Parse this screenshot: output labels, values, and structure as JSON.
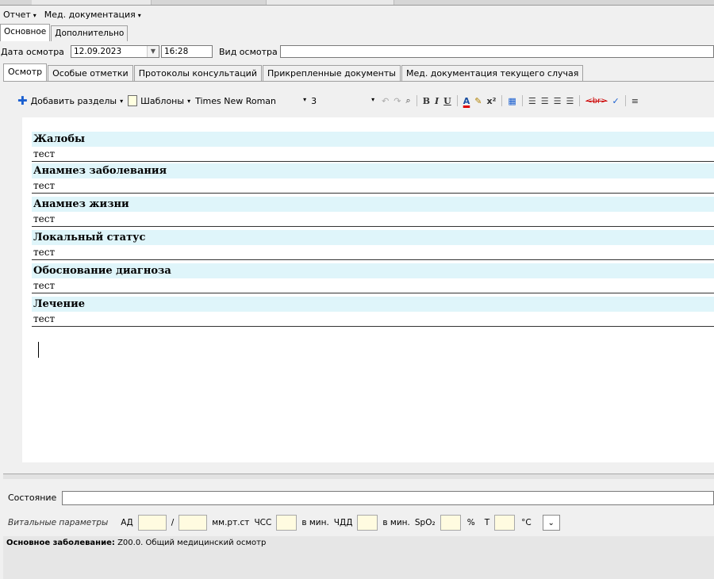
{
  "menu": [
    {
      "label": "Отчет",
      "caret": "▾"
    },
    {
      "label": "Мед. документация",
      "caret": "▾"
    }
  ],
  "top_tabs": [
    "Основное",
    "Дополнительно"
  ],
  "exam": {
    "date_label": "Дата осмотра",
    "date_value": "12.09.2023",
    "time_value": "16:28",
    "type_label": "Вид осмотра",
    "type_value": ""
  },
  "doc_tabs": [
    "Осмотр",
    "Особые отметки",
    "Протоколы консультаций",
    "Прикрепленные документы",
    "Мед. документация текущего случая"
  ],
  "toolbar": {
    "add_sections_label": "Добавить разделы",
    "templates_label": "Шаблоны",
    "font_name": "Times New Roman",
    "font_size": "3",
    "icons": [
      "undo-icon",
      "redo-icon",
      "find-icon",
      "bold-icon",
      "italic-icon",
      "underline-icon",
      "font-color-icon",
      "highlight-icon",
      "superscript-icon",
      "image-icon",
      "align-left-icon",
      "align-center-icon",
      "align-right-icon",
      "justify-icon",
      "strike-tag-icon",
      "spellcheck-icon",
      "list-icon"
    ]
  },
  "sections": [
    {
      "title": "Жалобы",
      "text": "тест"
    },
    {
      "title": "Анамнез заболевания",
      "text": "тест"
    },
    {
      "title": "Анамнез жизни",
      "text": "тест"
    },
    {
      "title": "Локальный статус",
      "text": "тест"
    },
    {
      "title": "Обоснование диагноза",
      "text": "тест"
    },
    {
      "title": "Лечение",
      "text": "тест"
    }
  ],
  "state": {
    "label": "Состояние",
    "value": ""
  },
  "vitals": {
    "label": "Витальные параметры",
    "ad_label": "АД",
    "slash": "/",
    "pressure_unit": "мм.рт.ст",
    "hr_label": "ЧСС",
    "hr_unit": "в мин.",
    "rr_label": "ЧДД",
    "rr_unit": "в мин.",
    "spo2_label": "SpO₂",
    "spo2_unit": "%",
    "temp_label": "Т",
    "temp_unit": "°С"
  },
  "diagnosis": {
    "label": "Основное заболевание:",
    "value": "Z00.0. Общий медицинский осмотр"
  },
  "colors": {
    "section_bg": "#dff5fa",
    "vital_box": "#fffbe0",
    "add_icon": "#1a5fd0"
  }
}
